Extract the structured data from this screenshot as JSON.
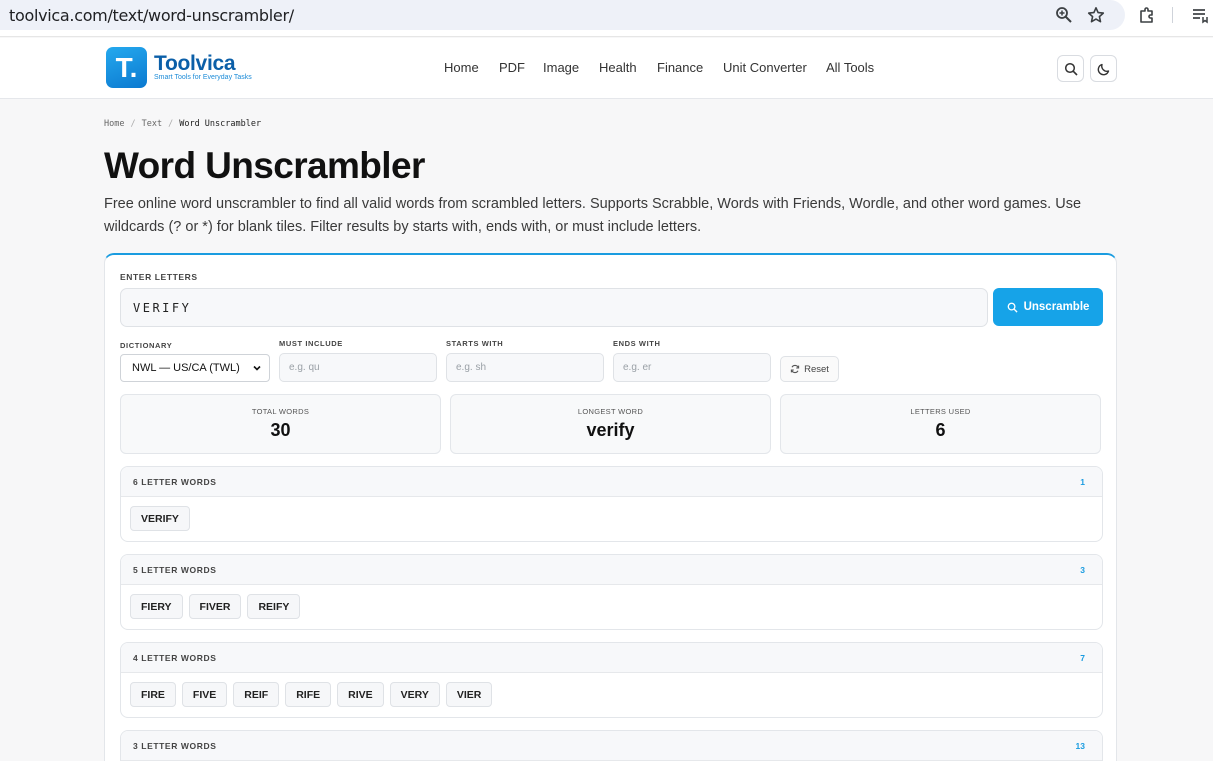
{
  "browser": {
    "url": "toolvica.com/text/word-unscrambler/"
  },
  "site": {
    "logo_letter": "T.",
    "name": "Toolvica",
    "tagline": "Smart Tools for Everyday Tasks",
    "nav": [
      "Home",
      "PDF",
      "Image",
      "Health",
      "Finance",
      "Unit Converter",
      "All Tools"
    ]
  },
  "breadcrumb": {
    "items": [
      "Home",
      "Text",
      "Word Unscrambler"
    ],
    "separator": "/"
  },
  "page": {
    "title": "Word Unscrambler",
    "description": "Free online word unscrambler to find all valid words from scrambled letters. Supports Scrabble, Words with Friends, Wordle, and other word games. Use wildcards (? or *) for blank tiles. Filter results by starts with, ends with, or must include letters."
  },
  "form": {
    "letters_label": "ENTER LETTERS",
    "letters_value": "VERIFY",
    "unscramble_label": "Unscramble",
    "dictionary_label": "DICTIONARY",
    "dictionary_value": "NWL — US/CA (TWL)",
    "must_include_label": "MUST INCLUDE",
    "must_include_placeholder": "e.g. qu",
    "starts_with_label": "STARTS WITH",
    "starts_with_placeholder": "e.g. sh",
    "ends_with_label": "ENDS WITH",
    "ends_with_placeholder": "e.g. er",
    "reset_label": "Reset"
  },
  "stats": [
    {
      "label": "TOTAL WORDS",
      "value": "30"
    },
    {
      "label": "LONGEST WORD",
      "value": "verify"
    },
    {
      "label": "LETTERS USED",
      "value": "6"
    }
  ],
  "groups": [
    {
      "title": "6 LETTER WORDS",
      "count": "1",
      "words": [
        "VERIFY"
      ]
    },
    {
      "title": "5 LETTER WORDS",
      "count": "3",
      "words": [
        "FIERY",
        "FIVER",
        "REIFY"
      ]
    },
    {
      "title": "4 LETTER WORDS",
      "count": "7",
      "words": [
        "FIRE",
        "FIVE",
        "REIF",
        "RIFE",
        "RIVE",
        "VERY",
        "VIER"
      ]
    },
    {
      "title": "3 LETTER WORDS",
      "count": "13",
      "words": []
    }
  ],
  "colors": {
    "accent": "#16a3e8",
    "brand_dark": "#0b5fa8"
  }
}
